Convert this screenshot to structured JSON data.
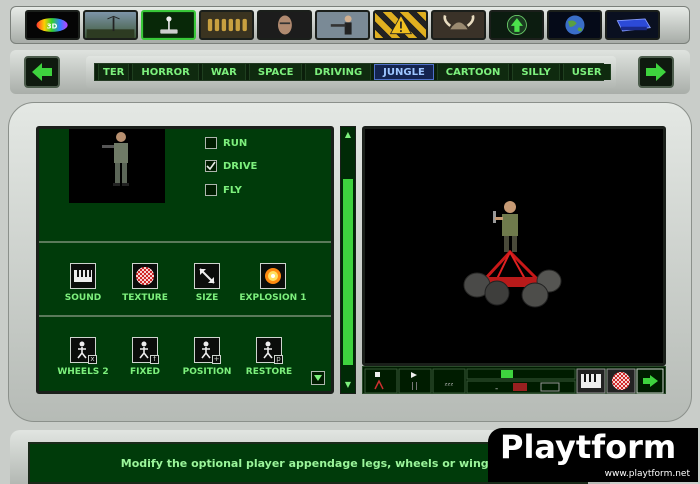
{
  "top_categories": [
    {
      "name": "rainbow-logo"
    },
    {
      "name": "landscape"
    },
    {
      "name": "joystick",
      "active": true
    },
    {
      "name": "ammo-belt"
    },
    {
      "name": "face-portrait"
    },
    {
      "name": "gunman"
    },
    {
      "name": "warning-sign"
    },
    {
      "name": "viking-helmet"
    },
    {
      "name": "green-up-arrow"
    },
    {
      "name": "earth-globe"
    },
    {
      "name": "blue-disk"
    }
  ],
  "genres": [
    "TER",
    "HORROR",
    "WAR",
    "SPACE",
    "DRIVING",
    "JUNGLE",
    "CARTOON",
    "SILLY",
    "USER"
  ],
  "active_genre": "JUNGLE",
  "movement_options": [
    {
      "label": "RUN",
      "checked": false
    },
    {
      "label": "DRIVE",
      "checked": true
    },
    {
      "label": "FLY",
      "checked": false
    }
  ],
  "tools_row1": [
    "SOUND",
    "TEXTURE",
    "SIZE",
    "EXPLOSION 1"
  ],
  "tools_row2": [
    "WHEELS 2",
    "FIXED",
    "POSITION",
    "RESTORE"
  ],
  "playback_labels": {
    "sleep": "ᶻᶻᶻ",
    "minus": "-"
  },
  "status": "Modify the optional player appendage legs, wheels or wings",
  "watermark": {
    "brand": "Playtform",
    "url": "www.playtform.net"
  },
  "colors": {
    "accent": "#7df07d",
    "panel": "#003b0a",
    "active_tab": "#142450"
  }
}
